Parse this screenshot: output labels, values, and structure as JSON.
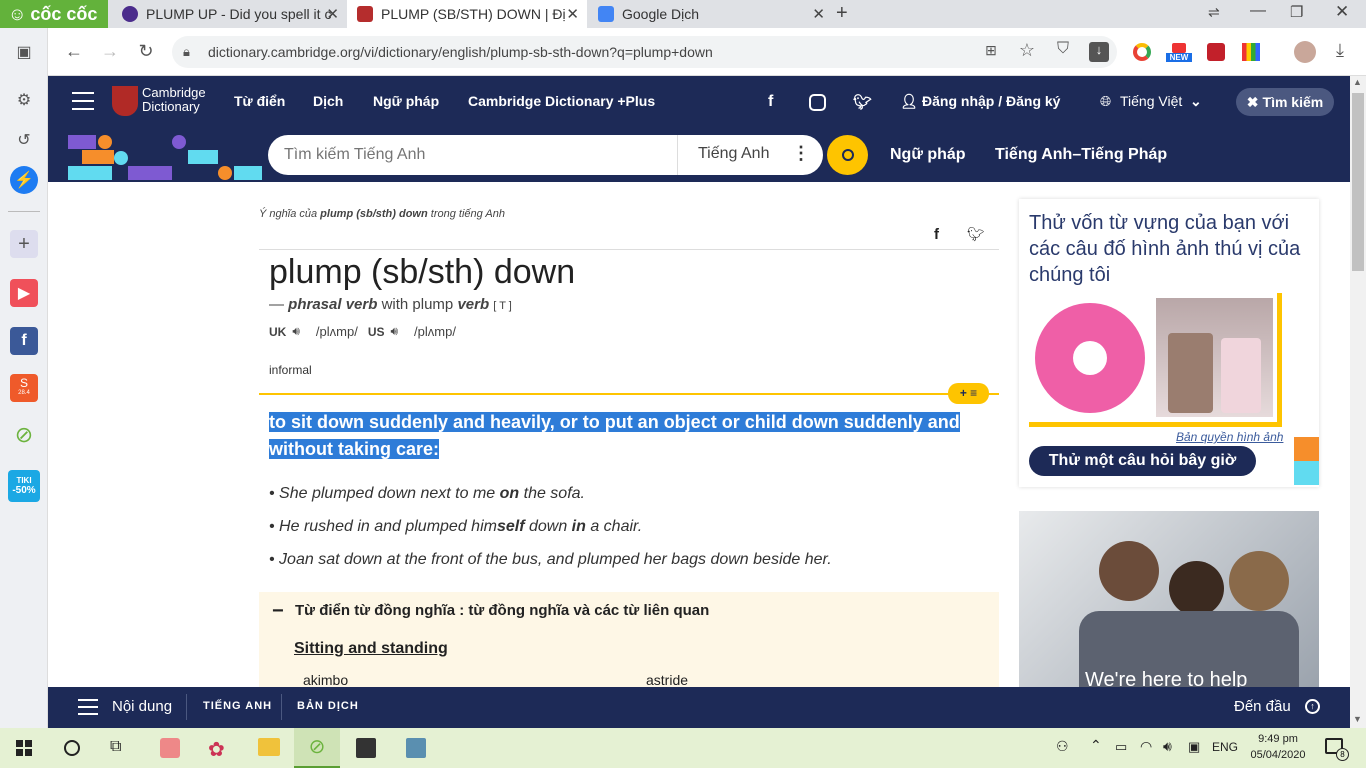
{
  "browser": {
    "brand": "cốc cốc",
    "tabs": [
      {
        "title": "PLUMP UP - Did you spell it c"
      },
      {
        "title": "PLUMP (SB/STH) DOWN | Địn"
      },
      {
        "title": "Google Dịch"
      }
    ],
    "url": "dictionary.cambridge.org/vi/dictionary/english/plump-sb-sth-down?q=plump+down",
    "new_badge": "NEW"
  },
  "header": {
    "logo_line1": "Cambridge",
    "logo_line2": "Dictionary",
    "nav": [
      "Từ điển",
      "Dịch",
      "Ngữ pháp",
      "Cambridge Dictionary +Plus"
    ],
    "login": "Đăng nhập / Đăng ký",
    "language": "Tiếng Việt",
    "search_btn": "Tìm kiếm"
  },
  "subheader": {
    "search_placeholder": "Tìm kiếm Tiếng Anh",
    "search_lang": "Tiếng Anh",
    "links": [
      "Ngữ pháp",
      "Tiếng Anh–Tiếng Pháp"
    ]
  },
  "entry": {
    "meaning_prefix": "Ý nghĩa của",
    "meaning_word": "plump (sb/sth) down",
    "meaning_suffix": "trong tiếng Anh",
    "headword": "plump (sb/sth) down",
    "dash": "—",
    "pos": "phrasal verb",
    "with": "with plump",
    "verb": "verb",
    "gram": "[ T ]",
    "uk": "UK",
    "uk_ipa": "/plʌmp/",
    "us": "US",
    "us_ipa": "/plʌmp/",
    "register": "informal",
    "definition": "to sit down suddenly and heavily, or to put an object or child down suddenly and without taking care:",
    "examples": [
      [
        "She plumped down next to me ",
        "on",
        " the sofa."
      ],
      [
        "He rushed in and plumped him",
        "self",
        " down ",
        "in",
        " a chair."
      ],
      [
        "Joan sat down at the front of the bus, and plumped her bags down beside her."
      ]
    ],
    "thesaurus_title": "Từ điển từ đồng nghĩa : từ đồng nghĩa và các từ liên quan",
    "thesaurus_group": "Sitting and standing",
    "thesaurus_words": [
      "akimbo",
      "astride"
    ]
  },
  "sidebar_ad": {
    "quiz_text": "Thử vốn từ vựng của bạn với các câu đố hình ảnh thú vị của chúng tôi",
    "copyright": "Bản quyền hình ảnh",
    "quiz_btn": "Thử một câu hỏi bây giờ",
    "banner_text": "We're here to help"
  },
  "bottombar": {
    "contents": "Nội dung",
    "tab1": "TIẾNG ANH",
    "tab2": "BẢN DỊCH",
    "top": "Đến đầu"
  },
  "taskbar": {
    "lang": "ENG",
    "time": "9:49 pm",
    "date": "05/04/2020",
    "notif": "8"
  },
  "apps": {
    "tiki": "TIKI",
    "tiki_sale": "-50%",
    "shopee_day": "28.4"
  }
}
